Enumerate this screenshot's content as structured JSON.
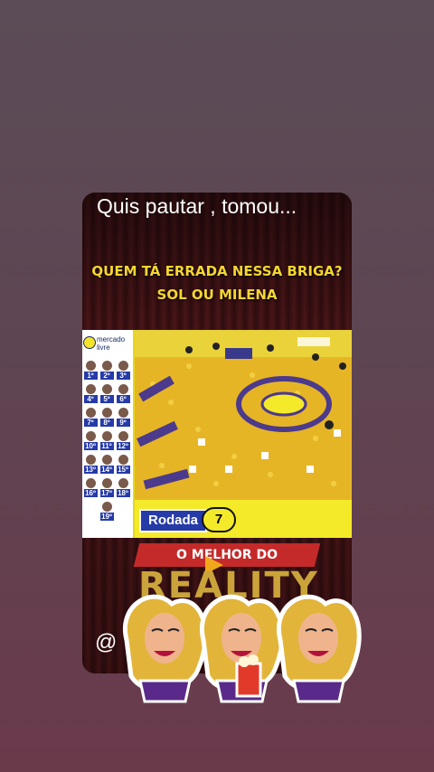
{
  "story": {
    "caption": "Quis pautar , tomou...",
    "headline_line1": "QUEM TÁ ERRADA NESSA BRIGA?",
    "headline_line2": "SOL OU MILENA",
    "handle": "@"
  },
  "broadcast": {
    "sponsor_line1": "mercado",
    "sponsor_line2": "livre",
    "ranking": [
      [
        "1º",
        "2º",
        "3º"
      ],
      [
        "4º",
        "5º",
        "6º"
      ],
      [
        "7º",
        "8º",
        "9º"
      ],
      [
        "10º",
        "11º",
        "12º"
      ],
      [
        "13º",
        "14º",
        "15º"
      ],
      [
        "16º",
        "17º",
        "18º"
      ],
      [
        "19º"
      ]
    ],
    "round_label": "Rodada",
    "round_number": "7"
  },
  "branding": {
    "tag": "O MELHOR DO",
    "title": "REALITY"
  },
  "colors": {
    "accent_yellow": "#f4ea2a",
    "accent_blue": "#263aa8",
    "headline_yellow": "#f5d631"
  }
}
